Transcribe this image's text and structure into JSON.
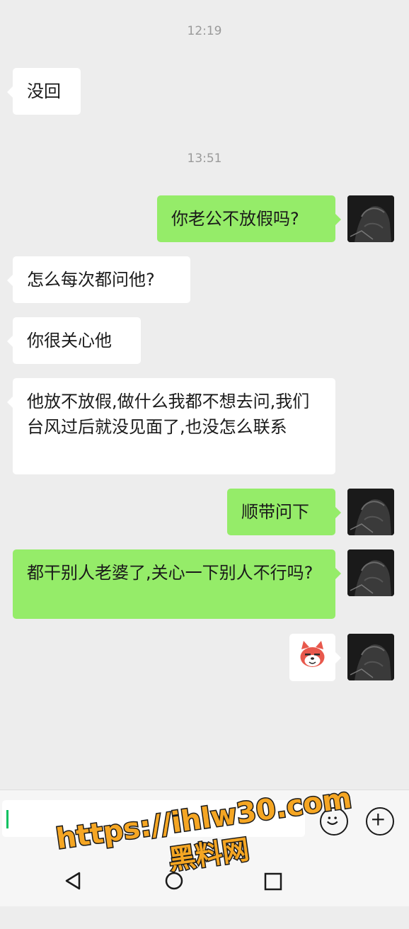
{
  "chat": {
    "messages": [
      {
        "type": "time",
        "text": "12:19"
      },
      {
        "type": "text",
        "side": "left",
        "text": "没回"
      },
      {
        "type": "time",
        "text": "13:51"
      },
      {
        "type": "text",
        "side": "right",
        "text": "你老公不放假吗?"
      },
      {
        "type": "text",
        "side": "left",
        "text": "怎么每次都问他?"
      },
      {
        "type": "text",
        "side": "left",
        "text": "你很关心他"
      },
      {
        "type": "text",
        "side": "left",
        "text": "他放不放假,做什么我都不想去问,我们台风过后就没见面了,也没怎么联系"
      },
      {
        "type": "text",
        "side": "right",
        "text": "顺带问下"
      },
      {
        "type": "text",
        "side": "right",
        "text": "都干别人老婆了,关心一下别人不行吗?"
      },
      {
        "type": "sticker",
        "side": "right",
        "icon": "shiba-dog-sticker-icon"
      }
    ]
  },
  "watermark": {
    "line1": "https://ihlw30.com",
    "line2": "黑料网",
    "color": "#f5a623"
  },
  "colors": {
    "sent_bubble": "#95ec69",
    "received_bubble": "#ffffff",
    "background": "#ededed",
    "cursor": "#07c160"
  },
  "icons": {
    "emoji": "emoji-face-icon",
    "more": "plus-circle-icon",
    "nav_back": "back-triangle-icon",
    "nav_home": "home-circle-icon",
    "nav_recents": "recents-square-icon"
  }
}
